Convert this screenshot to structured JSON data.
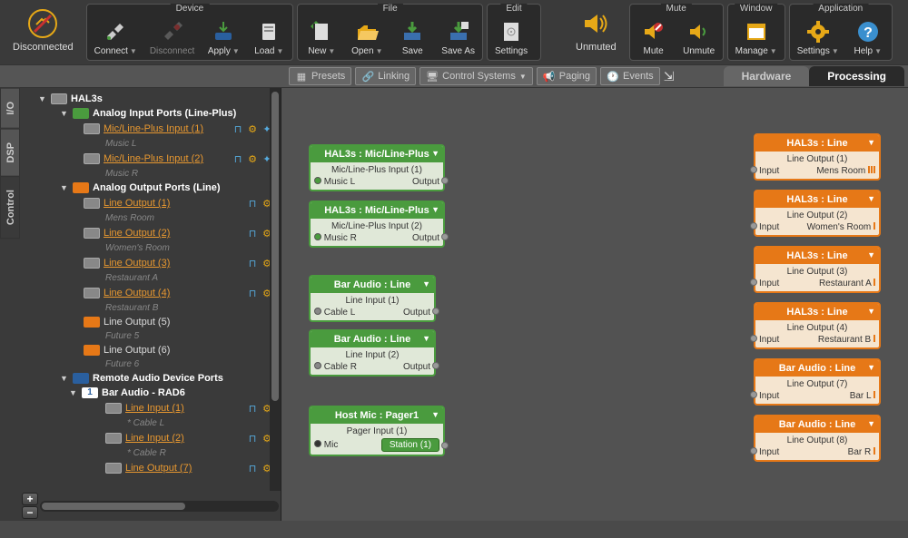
{
  "status": {
    "connection": "Disconnected",
    "mute": "Unmuted"
  },
  "toolbar_groups": {
    "device": {
      "title": "Device",
      "connect": "Connect",
      "disconnect": "Disconnect",
      "apply": "Apply",
      "load": "Load"
    },
    "file": {
      "title": "File",
      "new": "New",
      "open": "Open",
      "save": "Save",
      "saveas": "Save As"
    },
    "edit": {
      "title": "Edit",
      "settings": "Settings"
    },
    "mute_g": {
      "title": "Mute",
      "mute": "Mute",
      "unmute": "Unmute"
    },
    "window": {
      "title": "Window",
      "manage": "Manage"
    },
    "application": {
      "title": "Application",
      "settings": "Settings",
      "help": "Help"
    }
  },
  "secondary": {
    "presets": "Presets",
    "linking": "Linking",
    "control": "Control Systems",
    "paging": "Paging",
    "events": "Events"
  },
  "tabs": {
    "hardware": "Hardware",
    "processing": "Processing"
  },
  "side_tabs": {
    "io": "I/O",
    "dsp": "DSP",
    "control": "Control"
  },
  "tree": {
    "root": "HAL3s",
    "analog_in": {
      "title": "Analog Input Ports (Line-Plus)",
      "items": [
        {
          "name": "Mic/Line-Plus Input (1)",
          "sub": "Music L"
        },
        {
          "name": "Mic/Line-Plus Input (2)",
          "sub": "Music R"
        }
      ]
    },
    "analog_out": {
      "title": "Analog Output Ports (Line)",
      "items": [
        {
          "name": "Line Output (1)",
          "sub": "Mens Room"
        },
        {
          "name": "Line Output (2)",
          "sub": "Women's Room"
        },
        {
          "name": "Line Output (3)",
          "sub": "Restaurant A"
        },
        {
          "name": "Line Output (4)",
          "sub": "Restaurant B"
        },
        {
          "name": "Line Output (5)",
          "sub": "Future 5",
          "plain": true
        },
        {
          "name": "Line Output (6)",
          "sub": "Future 6",
          "plain": true
        }
      ]
    },
    "remote": {
      "title": "Remote Audio Device Ports",
      "device_num": "1",
      "device": "Bar Audio - RAD6",
      "items": [
        {
          "name": "Line Input (1)",
          "sub": "* Cable L"
        },
        {
          "name": "Line Input (2)",
          "sub": "* Cable R"
        },
        {
          "name": "Line Output (7)"
        }
      ]
    }
  },
  "nodes": {
    "in1": {
      "title": "HAL3s : Mic/Line-Plus",
      "l1": "Mic/Line-Plus Input (1)",
      "l2": "Music L",
      "out": "Output"
    },
    "in2": {
      "title": "HAL3s : Mic/Line-Plus",
      "l1": "Mic/Line-Plus Input (2)",
      "l2": "Music R",
      "out": "Output"
    },
    "bar1": {
      "title": "Bar Audio : Line",
      "l1": "Line Input (1)",
      "l2": "Cable L",
      "out": "Output"
    },
    "bar2": {
      "title": "Bar Audio : Line",
      "l1": "Line Input (2)",
      "l2": "Cable R",
      "out": "Output"
    },
    "pager": {
      "title": "Host Mic : Pager1",
      "l1": "Pager Input (1)",
      "l2": "Mic",
      "station": "Station (1)"
    },
    "out1": {
      "title": "HAL3s : Line",
      "l1": "Line Output (1)",
      "in": "Input",
      "name": "Mens Room"
    },
    "out2": {
      "title": "HAL3s : Line",
      "l1": "Line Output (2)",
      "in": "Input",
      "name": "Women's Room"
    },
    "out3": {
      "title": "HAL3s : Line",
      "l1": "Line Output (3)",
      "in": "Input",
      "name": "Restaurant A"
    },
    "out4": {
      "title": "HAL3s : Line",
      "l1": "Line Output (4)",
      "in": "Input",
      "name": "Restaurant B"
    },
    "out7": {
      "title": "Bar Audio : Line",
      "l1": "Line Output (7)",
      "in": "Input",
      "name": "Bar L"
    },
    "out8": {
      "title": "Bar Audio : Line",
      "l1": "Line Output (8)",
      "in": "Input",
      "name": "Bar R"
    }
  }
}
